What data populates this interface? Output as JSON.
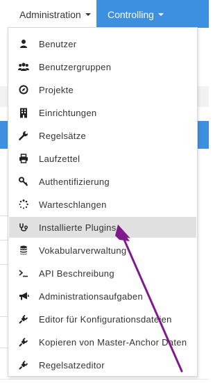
{
  "colors": {
    "accent": "#3d8fe0",
    "active_item_bg": "#e0e0e0",
    "annotation_arrow": "#7f1a8c"
  },
  "navbar": {
    "administration": "Administration",
    "controlling": "Controlling"
  },
  "menu": {
    "items": [
      {
        "label": "Benutzer",
        "icon": "user-icon"
      },
      {
        "label": "Benutzergruppen",
        "icon": "users-icon"
      },
      {
        "label": "Projekte",
        "icon": "compass-icon"
      },
      {
        "label": "Einrichtungen",
        "icon": "building-icon"
      },
      {
        "label": "Regelsätze",
        "icon": "wrench-icon"
      },
      {
        "label": "Laufzettel",
        "icon": "print-icon"
      },
      {
        "label": "Authentifizierung",
        "icon": "key-icon"
      },
      {
        "label": "Warteschlangen",
        "icon": "spinner-icon"
      },
      {
        "label": "Installierte Plugins",
        "icon": "stethoscope-icon",
        "active": true
      },
      {
        "label": "Vokabularverwaltung",
        "icon": "database-icon"
      },
      {
        "label": "API Beschreibung",
        "icon": "terminal-icon"
      },
      {
        "label": "Administrationsaufgaben",
        "icon": "bullhorn-icon"
      },
      {
        "label": "Editor für Konfigurationsdateien",
        "icon": "plug-icon"
      },
      {
        "label": "Kopieren von Master-Anchor Daten",
        "icon": "plug-icon"
      },
      {
        "label": "Regelsatzeditor",
        "icon": "plug-icon"
      }
    ]
  }
}
